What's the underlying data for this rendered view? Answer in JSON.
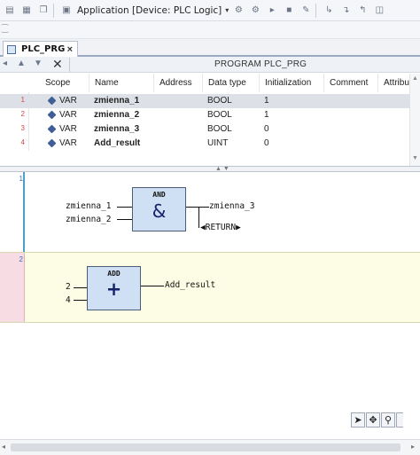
{
  "toolbar": {
    "application_label": "Application [Device: PLC Logic]",
    "dropdown_glyph": "▾"
  },
  "tab": {
    "label": "PLC_PRG",
    "close_glyph": "×"
  },
  "declaration": {
    "title": "PROGRAM PLC_PRG",
    "columns": [
      "Scope",
      "Name",
      "Address",
      "Data type",
      "Initialization",
      "Comment",
      "Attributes"
    ],
    "rows": [
      {
        "num": "1",
        "scope": "VAR",
        "name": "zmienna_1",
        "address": "",
        "type": "BOOL",
        "init": "1",
        "comment": ""
      },
      {
        "num": "2",
        "scope": "VAR",
        "name": "zmienna_2",
        "address": "",
        "type": "BOOL",
        "init": "1",
        "comment": ""
      },
      {
        "num": "3",
        "scope": "VAR",
        "name": "zmienna_3",
        "address": "",
        "type": "BOOL",
        "init": "0",
        "comment": ""
      },
      {
        "num": "4",
        "scope": "VAR",
        "name": "Add_result",
        "address": "",
        "type": "UINT",
        "init": "0",
        "comment": ""
      }
    ]
  },
  "fbd": {
    "networks": [
      {
        "num": "1",
        "block_name": "AND",
        "symbol": "&",
        "inputs": [
          "zmienna_1",
          "zmienna_2"
        ],
        "output": "zmienna_3",
        "return_label": "RETURN"
      },
      {
        "num": "2",
        "block_name": "ADD",
        "symbol": "+",
        "inputs": [
          "2",
          "4"
        ],
        "output": "Add_result"
      }
    ]
  }
}
